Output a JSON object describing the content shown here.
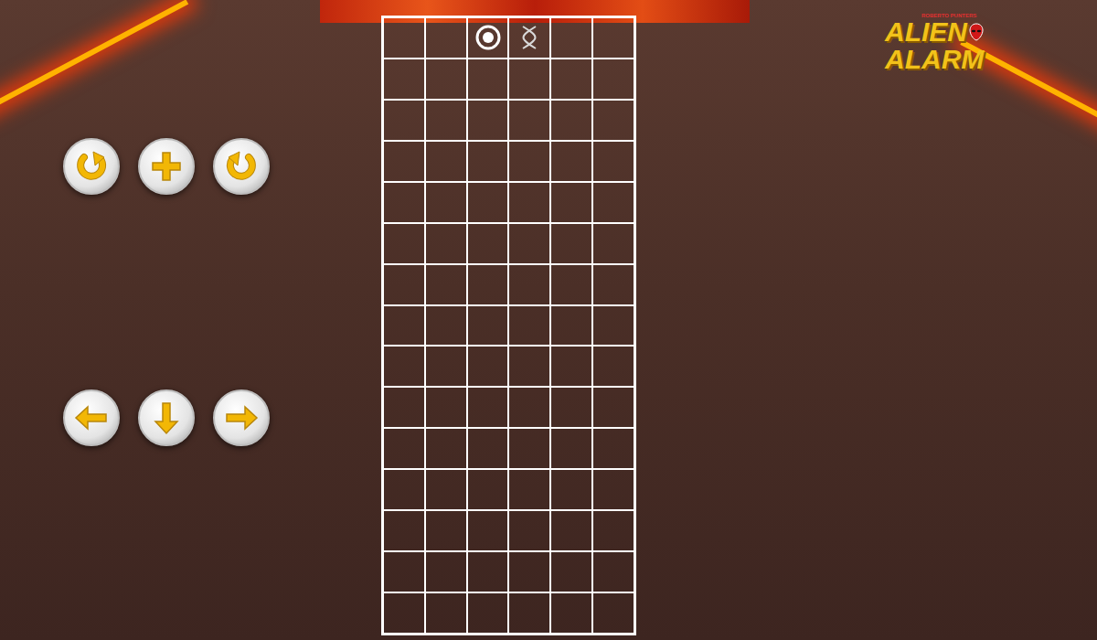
{
  "logo": {
    "byline": "ROBERTO PUNTERS",
    "title_top": "ALIEN",
    "title_bottom": "ALARM"
  },
  "controls": [
    [
      {
        "kind": "rotate-right"
      },
      {
        "kind": "plus"
      },
      {
        "kind": "rotate-left"
      }
    ],
    [
      {
        "kind": "left"
      },
      {
        "kind": "down"
      },
      {
        "kind": "right"
      }
    ]
  ],
  "board": {
    "rows": [
      [
        "empty",
        "empty",
        "ring",
        "cross",
        "empty",
        "empty"
      ],
      [
        "empty",
        "empty",
        "empty",
        "empty",
        "empty",
        "empty"
      ],
      [
        "empty",
        "empty",
        "empty",
        "empty",
        "empty",
        "empty"
      ],
      [
        "empty",
        "empty",
        "empty",
        "empty",
        "empty",
        "empty"
      ],
      [
        "empty",
        "empty",
        "empty",
        "empty",
        "empty",
        "empty"
      ],
      [
        "empty",
        "empty",
        "empty",
        "empty",
        "empty",
        "empty"
      ],
      [
        "empty",
        "empty",
        "empty",
        "empty",
        "empty",
        "empty"
      ],
      [
        "empty",
        "empty",
        "empty",
        "empty",
        "empty",
        "empty"
      ],
      [
        "empty",
        "empty",
        "empty",
        "empty",
        "empty",
        "empty"
      ],
      [
        "empty",
        "empty",
        "empty",
        "empty",
        "empty",
        "empty"
      ],
      [
        "empty",
        "empty",
        "empty",
        "empty",
        "empty",
        "empty"
      ],
      [
        "empty",
        "empty",
        "empty",
        "empty",
        "empty",
        "empty"
      ],
      [
        "empty",
        "empty",
        "empty",
        "empty",
        "empty",
        "empty"
      ],
      [
        "empty",
        "empty",
        "empty",
        "empty",
        "empty",
        "empty"
      ],
      [
        "empty",
        "empty",
        "empty",
        "empty",
        "empty",
        "empty"
      ]
    ]
  }
}
